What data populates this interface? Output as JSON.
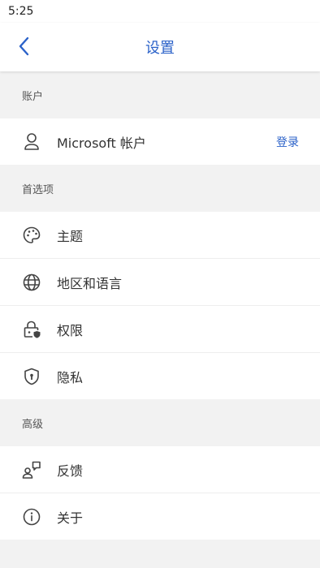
{
  "status_bar": {
    "time": "5:25"
  },
  "header": {
    "title": "设置"
  },
  "sections": {
    "account": {
      "heading": "账户",
      "items": [
        {
          "label": "Microsoft 帐户",
          "action": "登录",
          "icon": "person-icon"
        }
      ]
    },
    "preferences": {
      "heading": "首选项",
      "items": [
        {
          "label": "主题",
          "icon": "palette-icon"
        },
        {
          "label": "地区和语言",
          "icon": "globe-icon"
        },
        {
          "label": "权限",
          "icon": "lock-shield-icon"
        },
        {
          "label": "隐私",
          "icon": "shield-icon"
        }
      ]
    },
    "advanced": {
      "heading": "高级",
      "items": [
        {
          "label": "反馈",
          "icon": "feedback-icon"
        },
        {
          "label": "关于",
          "icon": "info-icon"
        }
      ]
    }
  },
  "colors": {
    "accent": "#2b62c9",
    "background": "#f2f2f2",
    "surface": "#ffffff"
  }
}
